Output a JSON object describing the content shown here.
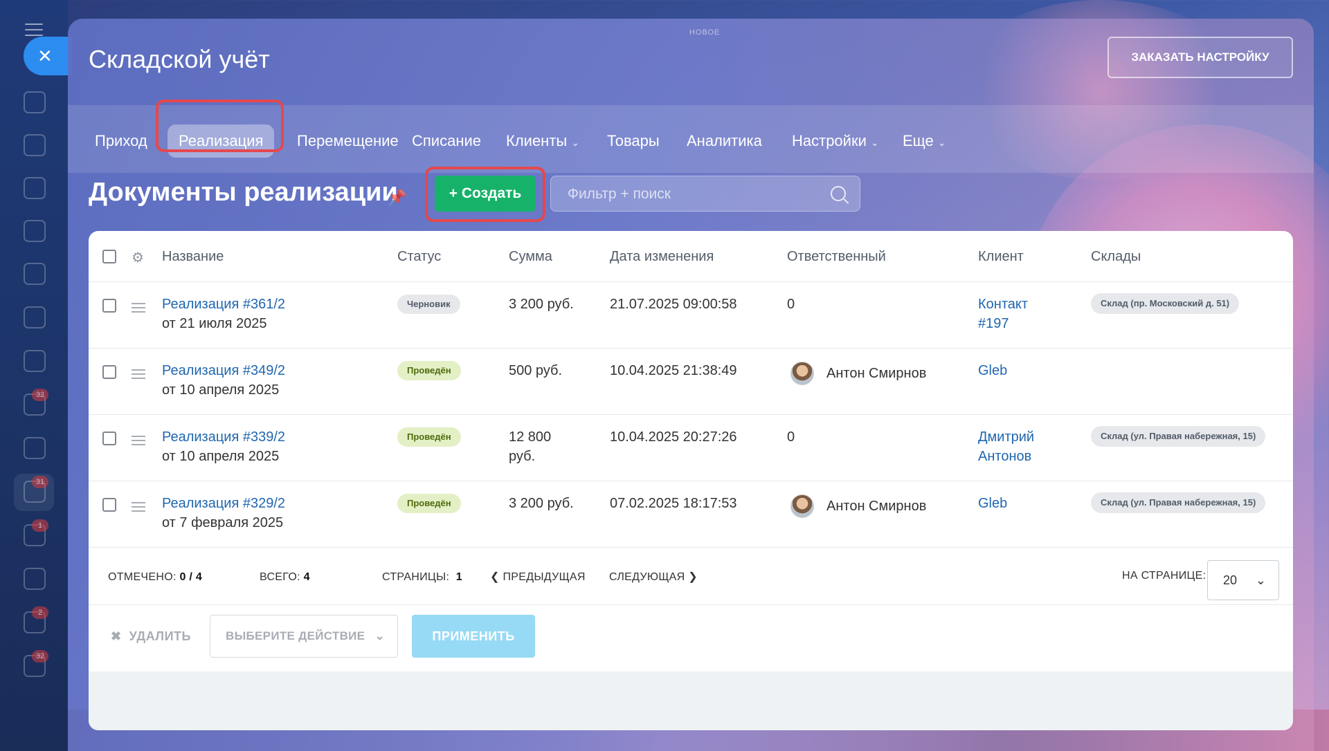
{
  "top_label": "НОВОЕ",
  "panel": {
    "title": "Складской учёт",
    "order_button": "ЗАКАЗАТЬ НАСТРОЙКУ"
  },
  "tabs": [
    {
      "label": "Приход",
      "active": false
    },
    {
      "label": "Реализация",
      "active": true
    },
    {
      "label": "Перемещение",
      "active": false
    },
    {
      "label": "Списание",
      "active": false
    },
    {
      "label": "Клиенты",
      "active": false,
      "dropdown": true
    },
    {
      "label": "Товары",
      "active": false
    },
    {
      "label": "Аналитика",
      "active": false
    },
    {
      "label": "Настройки",
      "active": false,
      "dropdown": true
    },
    {
      "label": "Еще",
      "active": false,
      "dropdown": true
    }
  ],
  "page": {
    "heading": "Документы реализации",
    "create_button": "Создать",
    "search_placeholder": "Фильтр + поиск"
  },
  "rail_badges": [
    "32",
    "31",
    "1",
    "2",
    "32"
  ],
  "table": {
    "columns": [
      "Название",
      "Статус",
      "Сумма",
      "Дата изменения",
      "Ответственный",
      "Клиент",
      "Склады"
    ],
    "rows": [
      {
        "name": "Реализация #361/2",
        "date_sub": "от 21 июля 2025",
        "status": "Черновик",
        "status_type": "draft",
        "sum_line1": "3 200 руб.",
        "sum_line2": "",
        "modified": "21.07.2025 09:00:58",
        "responsible": "0",
        "has_avatar": false,
        "client_line1": "Контакт",
        "client_line2": "#197",
        "warehouse": "Склад (пр. Московский д. 51)"
      },
      {
        "name": "Реализация #349/2",
        "date_sub": "от 10 апреля 2025",
        "status": "Проведён",
        "status_type": "done",
        "sum_line1": "500 руб.",
        "sum_line2": "",
        "modified": "10.04.2025 21:38:49",
        "responsible": "Антон Смирнов",
        "has_avatar": true,
        "client_line1": "Gleb",
        "client_line2": "",
        "warehouse": ""
      },
      {
        "name": "Реализация #339/2",
        "date_sub": "от 10 апреля 2025",
        "status": "Проведён",
        "status_type": "done",
        "sum_line1": "12 800",
        "sum_line2": "руб.",
        "modified": "10.04.2025 20:27:26",
        "responsible": "0",
        "has_avatar": false,
        "client_line1": "Дмитрий",
        "client_line2": "Антонов",
        "warehouse": "Склад (ул. Правая набережная, 15)"
      },
      {
        "name": "Реализация #329/2",
        "date_sub": "от 7 февраля 2025",
        "status": "Проведён",
        "status_type": "done",
        "sum_line1": "3 200 руб.",
        "sum_line2": "",
        "modified": "07.02.2025 18:17:53",
        "responsible": "Антон Смирнов",
        "has_avatar": true,
        "client_line1": "Gleb",
        "client_line2": "",
        "warehouse": "Склад (ул. Правая набережная, 15)"
      }
    ]
  },
  "footer": {
    "selected_label": "ОТМЕЧЕНО:",
    "selected_value": "0 / 4",
    "total_label": "ВСЕГО:",
    "total_value": "4",
    "pages_label": "СТРАНИЦЫ:",
    "pages_value": "1",
    "prev": "ПРЕДЫДУЩАЯ",
    "next": "СЛЕДУЮЩАЯ",
    "per_page_label": "НА СТРАНИЦЕ:",
    "per_page_value": "20"
  },
  "actions": {
    "delete": "УДАЛИТЬ",
    "select_action": "ВЫБЕРИТЕ ДЕЙСТВИЕ",
    "apply": "ПРИМЕНИТЬ"
  },
  "colors": {
    "create_button": "#17b26a",
    "highlight": "#e5484d",
    "link": "#2067b0",
    "apply_button": "#97daf5"
  }
}
